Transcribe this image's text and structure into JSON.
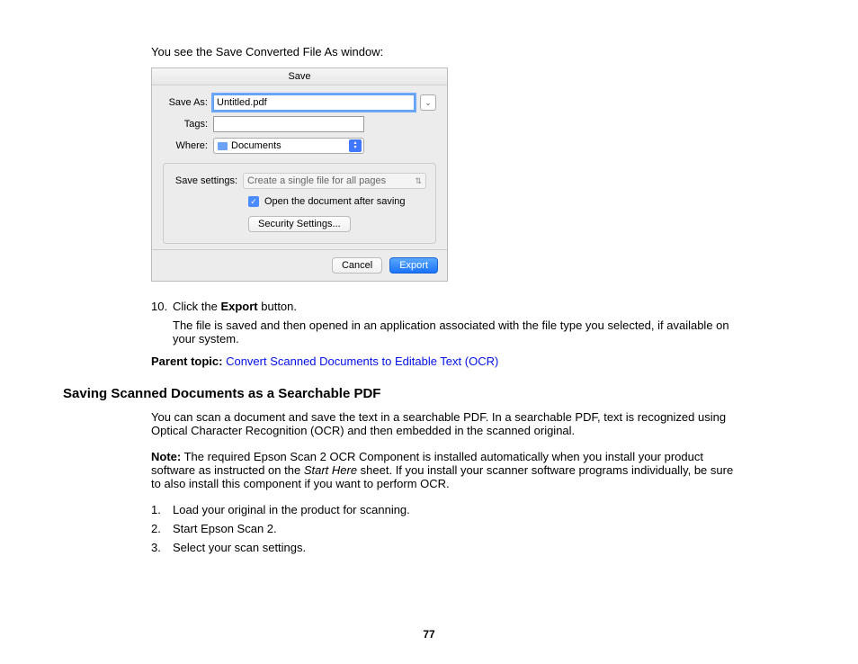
{
  "intro": "You see the Save Converted File As window:",
  "dialog": {
    "title": "Save",
    "saveAsLabel": "Save As:",
    "saveAsValue": "Untitled.pdf",
    "tagsLabel": "Tags:",
    "tagsValue": "",
    "whereLabel": "Where:",
    "whereValue": "Documents",
    "saveSettingsLabel": "Save settings:",
    "saveSettingsValue": "Create a single file for all pages",
    "checkboxLabel": "Open the document after saving",
    "securityBtn": "Security Settings...",
    "cancelBtn": "Cancel",
    "exportBtn": "Export"
  },
  "step10": {
    "num": "10.",
    "textPrefix": "Click the ",
    "bold": "Export",
    "textSuffix": " button.",
    "sub": "The file is saved and then opened in an application associated with the file type you selected, if available on your system."
  },
  "parentTopic": {
    "label": "Parent topic: ",
    "link": "Convert Scanned Documents to Editable Text (OCR)"
  },
  "heading": "Saving Scanned Documents as a Searchable PDF",
  "para1": "You can scan a document and save the text in a searchable PDF. In a searchable PDF, text is recognized using Optical Character Recognition (OCR) and then embedded in the scanned original.",
  "note": {
    "label": "Note:",
    "textA": " The required Epson Scan 2 OCR Component is installed automatically when you install your product software as instructed on the ",
    "italic": "Start Here",
    "textB": " sheet. If you install your scanner software programs individually, be sure to also install this component if you want to perform OCR."
  },
  "steps": [
    {
      "num": "1.",
      "text": "Load your original in the product for scanning."
    },
    {
      "num": "2.",
      "text": "Start Epson Scan 2."
    },
    {
      "num": "3.",
      "text": "Select your scan settings."
    }
  ],
  "pageNumber": "77"
}
